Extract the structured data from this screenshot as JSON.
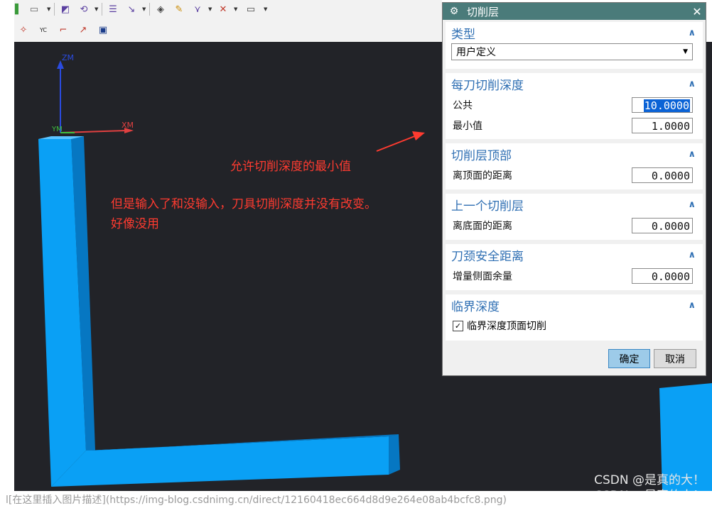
{
  "dialog": {
    "title": "切削层",
    "groups": {
      "type": {
        "title": "类型",
        "select_value": "用户定义"
      },
      "depth": {
        "title": "每刀切削深度",
        "common_label": "公共",
        "common_value": "10.0000",
        "min_label": "最小值",
        "min_value": "1.0000"
      },
      "top": {
        "title": "切削层顶部",
        "label": "离顶面的距离",
        "value": "0.0000"
      },
      "prev": {
        "title": "上一个切削层",
        "label": "离底面的距离",
        "value": "0.0000"
      },
      "neck": {
        "title": "刀颈安全距离",
        "label": "增量侧面余量",
        "value": "0.0000"
      },
      "critical": {
        "title": "临界深度",
        "checkbox_label": "临界深度顶面切削",
        "checked": true
      }
    },
    "ok_label": "确定",
    "cancel_label": "取消"
  },
  "viewport": {
    "axis_z": "ZM",
    "axis_x": "XM",
    "axis_y": "YM",
    "toolbar_yc": "YC"
  },
  "annotations": {
    "note1": "允许切削深度的最小值",
    "note2_line1": "但是输入了和没输入，刀具切削深度并没有改变。",
    "note2_line2": "好像没用"
  },
  "watermarks": [
    "CSDN @是真的大！",
    "CSDN @是真的大！"
  ],
  "caption": "l[在这里插入图片描述](https://img-blog.csdnimg.cn/direct/12160418ec664d8d9e264e08ab4bcfc8.png)",
  "colors": {
    "title_bar": "#4a7b7a",
    "group_title": "#2f6fb3",
    "model_blue": "#0aa0f5",
    "annotation_red": "#ff3b30"
  }
}
